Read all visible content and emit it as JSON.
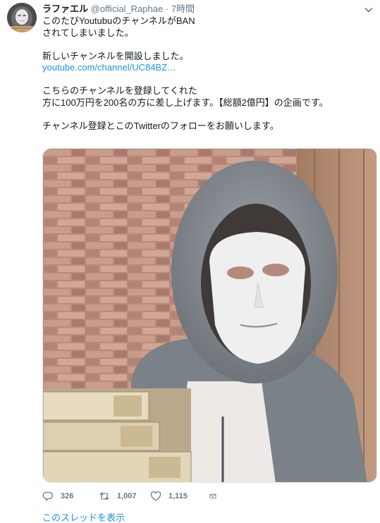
{
  "tweet": {
    "display_name": "ラファエル",
    "handle": "@official_Raphae",
    "separator": "·",
    "time": "7時間",
    "lines": [
      "このたびYoutubuのチャンネルがBAN",
      "されてしまいました。",
      "",
      "新しいチャンネルを開設しました。",
      "youtube.com/channel/UC84BZ…",
      "",
      "こちらのチャンネルを登録してくれた",
      "方に100万円を200名の方に差し上げます。【総額2億円】の企画です。",
      "",
      "チャンネル登録とこのTwitterのフォローをお願いします。"
    ]
  },
  "actions": {
    "reply_count": "326",
    "retweet_count": "1,007",
    "like_count": "1,115"
  },
  "thread_link": "このスレッドを表示",
  "icons": {
    "menu": "chevron-down-icon",
    "reply": "reply-icon",
    "retweet": "retweet-icon",
    "like": "heart-icon",
    "dm": "envelope-icon"
  },
  "colors": {
    "link": "#1b95e0",
    "secondary_text": "#657786",
    "primary_text": "#14171a"
  }
}
